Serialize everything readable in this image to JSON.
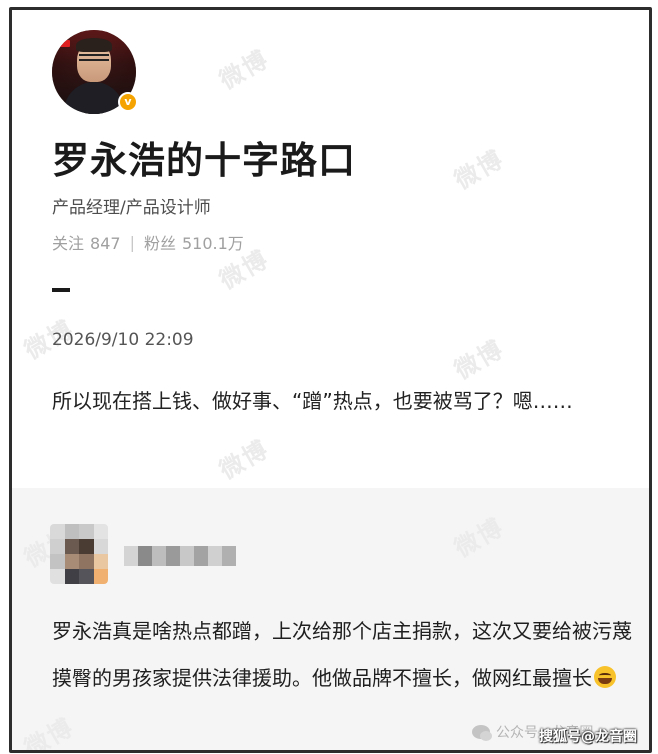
{
  "profile": {
    "name": "罗永浩的十字路口",
    "title": "产品经理/产品设计师",
    "avatar_caption": "罗永浩\n的十字路口",
    "verified_icon": "v",
    "stats": {
      "following_label": "关注",
      "following_count": "847",
      "followers_label": "粉丝",
      "followers_count": "510.1万",
      "separator": "|"
    }
  },
  "post": {
    "timestamp": "2026/9/10 22:09",
    "text": "所以现在搭上钱、做好事、“蹭”热点，也要被骂了？嗯……"
  },
  "comment": {
    "text": "罗永浩真是啥热点都蹭，上次给那个店主捐款，这次又要给被污蔑摸臀的男孩家提供法律援助。他做品牌不擅长，做网红最擅长"
  },
  "watermarks": {
    "weibo": "微博",
    "wechat": "公众号 · 龙音圈",
    "sohu": "搜狐号@龙音圈"
  },
  "colors": {
    "verified": "#f5a300",
    "frame_border": "#2d2d2d",
    "comment_bg": "#f5f5f5"
  }
}
